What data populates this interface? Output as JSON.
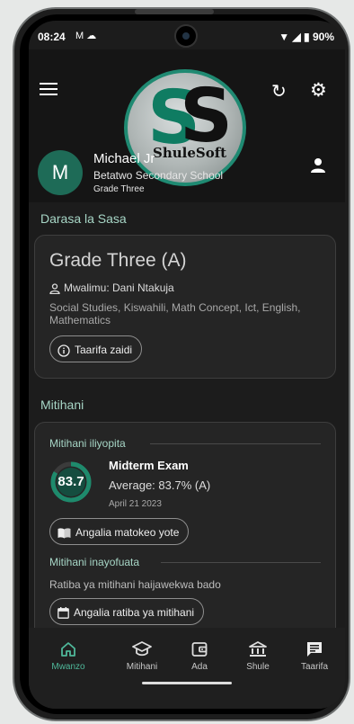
{
  "status_bar": {
    "time": "08:24",
    "left_icons": "M ☁",
    "battery": "90%"
  },
  "header": {
    "logo_text": "ShuleSoft",
    "logo_letters": "SS",
    "user": {
      "initial": "M",
      "name": "Michael Jr",
      "school": "Betatwo Secondary School",
      "grade": "Grade Three"
    }
  },
  "current_class": {
    "section_title": "Darasa la Sasa",
    "class_name": "Grade Three (A)",
    "teacher": "Mwalimu: Dani Ntakuja",
    "subjects": "Social Studies, Kiswahili, Math Concept, Ict, English, Mathematics",
    "more_info_button": "Taarifa zaidi"
  },
  "exams": {
    "section_title": "Mitihani",
    "past_label": "Mitihani iliyopita",
    "last_exam": {
      "score": "83.7",
      "score_fraction": 0.837,
      "name": "Midterm Exam",
      "average": "Average: 83.7% (A)",
      "date": "April 21 2023"
    },
    "view_results_button": "Angalia matokeo yote",
    "upcoming_label": "Mitihani inayofuata",
    "upcoming_message": "Ratiba ya mitihani haijawekwa bado",
    "view_schedule_button": "Angalia ratiba ya mitihani"
  },
  "bottom_nav": [
    {
      "label": "Mwanzo",
      "icon": "home-icon",
      "active": true
    },
    {
      "label": "Mitihani",
      "icon": "graduation-cap-icon",
      "active": false
    },
    {
      "label": "Ada",
      "icon": "wallet-icon",
      "active": false
    },
    {
      "label": "Shule",
      "icon": "school-building-icon",
      "active": false
    },
    {
      "label": "Taarifa",
      "icon": "message-icon",
      "active": false
    }
  ],
  "colors": {
    "accent": "#4fb89a",
    "brand": "#1e6b57",
    "section_title": "#a7d6c6",
    "card_bg": "#252525"
  }
}
